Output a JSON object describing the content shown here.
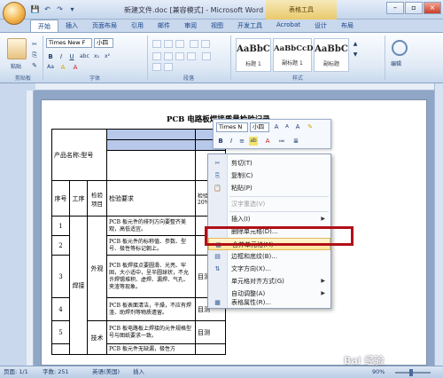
{
  "window": {
    "title": "新建文件.doc [兼容模式] - Microsoft Word",
    "contextual_tab_group": "表格工具",
    "controls": [
      "–",
      "▫",
      "×"
    ]
  },
  "quick_access": [
    "💾",
    "↶",
    "↷",
    "▾"
  ],
  "tabs": [
    "开始",
    "插入",
    "页面布局",
    "引用",
    "邮件",
    "审阅",
    "视图",
    "开发工具",
    "Acrobat",
    "设计",
    "布局"
  ],
  "ribbon": {
    "paste_label": "粘贴",
    "font_name": "Times New F",
    "font_size": "小四",
    "styles": [
      {
        "sample": "AaBbC",
        "name": "标题 1"
      },
      {
        "sample": "AaBbCcD",
        "name": "副标题 1"
      },
      {
        "sample": "AaBbC",
        "name": "副标题"
      }
    ],
    "edit_label": "编辑",
    "groups": [
      "剪贴板",
      "字体",
      "段落",
      "样式"
    ],
    "font_buttons": [
      "B",
      "I",
      "U",
      "abc",
      "x₂",
      "x²",
      "Aa",
      "A",
      "A"
    ]
  },
  "document": {
    "title": "PCB 电路板焊接质量检验记录",
    "product_label": "产品名称:型号",
    "headers": [
      "序号",
      "工序",
      "检验项目",
      "检验要求",
      "检验方法20%"
    ],
    "rows": [
      {
        "no": "1",
        "req": "PCB 板元件的排列方向要整齐美观，高低适宜。",
        "method": ""
      },
      {
        "no": "2",
        "req": "PCB 板元件的标称值、参数、型号、极性等标记朝上。",
        "method": ""
      },
      {
        "no": "3",
        "req": "PCB 板焊接点要圆滑、光亮、牢固，大小适中，呈半圆球状，不允许焊锡堆积、虚焊、漏焊、气孔、夹渣等现象。",
        "method": "目测"
      },
      {
        "no": "4",
        "req": "PCB 板表面清洁，干燥，不应有焊渣、助焊剂等物质遗留。",
        "method": "目测"
      },
      {
        "no": "5",
        "req": "PCB 板电路板上焊接的元件规格型号与图纸要求一致。",
        "method": "目测"
      },
      {
        "no": "",
        "req": "PCB 板元件无缺漏，极性方",
        "method": ""
      }
    ],
    "process": "焊接",
    "item_appearance": "外观",
    "item_tech": "技术"
  },
  "mini_toolbar": {
    "font_name": "Times N",
    "font_size": "小四",
    "buttons": [
      "A",
      "A",
      "A",
      "✎",
      "B",
      "I",
      "≡",
      "ab",
      "A",
      "≔",
      "≣"
    ]
  },
  "context_menu": {
    "items": [
      {
        "label": "剪切(T)",
        "icon": "✂",
        "disabled": false,
        "submenu": false
      },
      {
        "label": "复制(C)",
        "icon": "⎘",
        "disabled": false,
        "submenu": false
      },
      {
        "label": "粘贴(P)",
        "icon": "📋",
        "disabled": false,
        "submenu": false
      },
      {
        "label": "汉字重选(V)",
        "icon": "",
        "disabled": true,
        "submenu": false
      },
      {
        "label": "插入(I)",
        "icon": "",
        "disabled": false,
        "submenu": true
      },
      {
        "label": "删除单元格(D)...",
        "icon": "",
        "disabled": false,
        "submenu": false
      },
      {
        "label": "合并单元格(M)",
        "icon": "▦",
        "disabled": false,
        "submenu": false
      },
      {
        "label": "边框和底纹(B)...",
        "icon": "▤",
        "disabled": false,
        "submenu": false
      },
      {
        "label": "文字方向(X)...",
        "icon": "⇅",
        "disabled": false,
        "submenu": false
      },
      {
        "label": "单元格对齐方式(G)",
        "icon": "",
        "disabled": false,
        "submenu": true
      },
      {
        "label": "自动调整(A)",
        "icon": "",
        "disabled": false,
        "submenu": true
      },
      {
        "label": "表格属性(R)...",
        "icon": "▦",
        "disabled": false,
        "submenu": false
      }
    ],
    "highlighted_index": 6
  },
  "status": {
    "page": "页面: 1/1",
    "words": "字数: 251",
    "language": "英语(美国)",
    "mode": "插入",
    "zoom": "90%"
  },
  "watermark": "Bai 经验",
  "colors": {
    "accent": "#15428b",
    "highlight_box": "#b10f17",
    "table_shade": "#b7c8ea"
  }
}
